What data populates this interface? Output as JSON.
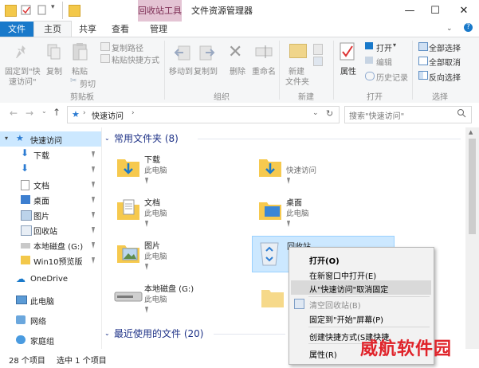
{
  "titlebar": {
    "contextual_tab": "回收站工具",
    "window_title": "文件资源管理器",
    "minimize": "—",
    "maximize": "☐",
    "close": "✕"
  },
  "tabs": [
    {
      "label": "文件"
    },
    {
      "label": "主页"
    },
    {
      "label": "共享"
    },
    {
      "label": "查看"
    },
    {
      "label": "管理"
    }
  ],
  "ribbon": {
    "clipboard": {
      "pin": "固定到\"快",
      "pin2": "速访问\"",
      "copy": "复制",
      "paste": "粘贴",
      "copy_path": "复制路径",
      "paste_shortcut": "粘贴快捷方式",
      "cut": "剪切",
      "group": "剪贴板"
    },
    "organize": {
      "move_to": "移动到",
      "copy_to": "复制到",
      "delete": "删除",
      "rename": "重命名",
      "group": "组织"
    },
    "new": {
      "new_folder": "新建",
      "new_folder2": "文件夹",
      "group": "新建"
    },
    "open": {
      "properties": "属性",
      "open": "打开",
      "edit": "编辑",
      "history": "历史记录",
      "group": "打开"
    },
    "select": {
      "select_all": "全部选择",
      "select_none": "全部取消",
      "invert": "反向选择",
      "group": "选择"
    }
  },
  "address": {
    "path": "快速访问",
    "search_placeholder": "搜索\"快速访问\""
  },
  "nav": {
    "items": [
      {
        "label": "快速访问"
      },
      {
        "label": "下载"
      },
      {
        "label": ""
      },
      {
        "label": "文档"
      },
      {
        "label": "桌面"
      },
      {
        "label": "图片"
      },
      {
        "label": "回收站"
      },
      {
        "label": "本地磁盘 (G:)"
      },
      {
        "label": "Win10预览版"
      },
      {
        "label": "OneDrive"
      },
      {
        "label": "此电脑"
      },
      {
        "label": "网络"
      },
      {
        "label": "家庭组"
      }
    ]
  },
  "content": {
    "frequent_header": "常用文件夹 (8)",
    "recent_header": "最近使用的文件 (20)",
    "items": [
      {
        "name": "下载",
        "sub": "此电脑"
      },
      {
        "name": "",
        "sub": "快速访问"
      },
      {
        "name": "文档",
        "sub": "此电脑"
      },
      {
        "name": "桌面",
        "sub": "此电脑"
      },
      {
        "name": "图片",
        "sub": "此电脑"
      },
      {
        "name": "回收站",
        "sub": ""
      },
      {
        "name": "本地磁盘 (G:)",
        "sub": "此电脑"
      }
    ]
  },
  "context_menu": {
    "items": [
      {
        "label": "打开(O)"
      },
      {
        "label": "在新窗口中打开(E)"
      },
      {
        "label": "从\"快速访问\"取消固定"
      },
      {
        "label": "清空回收站(B)"
      },
      {
        "label": "固定到\"开始\"屏幕(P)"
      },
      {
        "label": "创建快捷方式(S建快捷"
      },
      {
        "label": "属性(R)"
      }
    ]
  },
  "status": {
    "count": "28 个项目",
    "selected": "选中 1 个项目"
  },
  "watermark": "威航软件园",
  "colors": {
    "accent": "#1979ca",
    "tool_tab": "#e4c4d4",
    "group_header": "#1e3287",
    "folder": "#f6c94e"
  }
}
